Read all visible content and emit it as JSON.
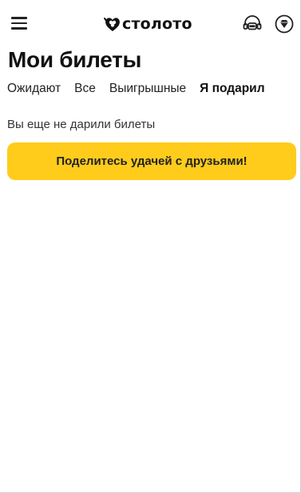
{
  "header": {
    "brand": "столото",
    "menu_icon": "hamburger-menu-icon",
    "support_icon": "headset-chat-icon",
    "bonus_icon": "diamond-icon"
  },
  "page": {
    "title": "Мои билеты"
  },
  "tabs": [
    {
      "label": "Ожидают",
      "active": false
    },
    {
      "label": "Все",
      "active": false
    },
    {
      "label": "Выигрышные",
      "active": false
    },
    {
      "label": "Я подарил",
      "active": true
    }
  ],
  "content": {
    "empty_message": "Вы еще не дарили билеты",
    "share_button_label": "Поделитесь удачей с друзьями!"
  },
  "colors": {
    "accent": "#ffcc1c",
    "text": "#1a1a1a",
    "background": "#ffffff"
  }
}
